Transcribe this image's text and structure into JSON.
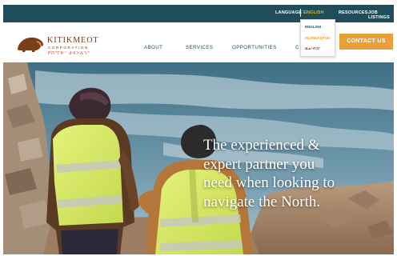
{
  "topbar": {
    "language_label": "LANGUAGE",
    "current_language": "ENGLISH",
    "resources": "RESOURCES",
    "job_listings": "JOB LISTINGS"
  },
  "language_menu": {
    "options": [
      "ENGLISH",
      "INUINNAQTUN",
      "ᐃᓄᒃᑎᑐᑦ"
    ]
  },
  "logo": {
    "name": "KITIKMEOT",
    "subtitle": "CORPORATION",
    "syllabics": "ᑭᑎᕐᒥᐅᑦ ᑯᐊᐳᕇᓴᓐ"
  },
  "nav": {
    "items": [
      "ABOUT",
      "SERVICES",
      "OPPORTUNITIES",
      "C"
    ]
  },
  "contact_button": "CONTACT US",
  "hero": {
    "lines": [
      "The experienced &",
      "expert partner you",
      "need when looking to",
      "navigate the North."
    ]
  },
  "colors": {
    "topbar": "#1f4d5a",
    "accent": "#e8a13a",
    "brand_brown": "#6b3b1f",
    "syllabics_red": "#c0392b"
  }
}
